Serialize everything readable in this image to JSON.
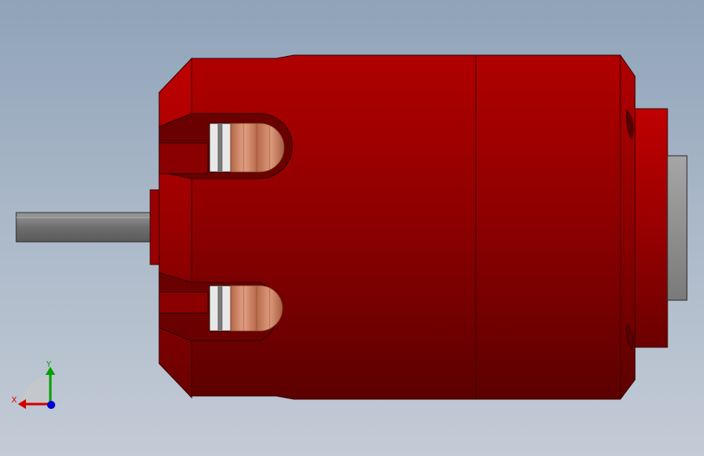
{
  "viewport": {
    "background_top": "#8fa3b9",
    "background_bottom": "#c3cbd6"
  },
  "model": {
    "body_color": "#b00000",
    "winding_color": "#c9785a",
    "shaft_color": "#707070"
  },
  "triad": {
    "x_label": "X",
    "y_label": "Y",
    "x_color": "#d40000",
    "y_color": "#00a000",
    "z_color": "#0000d0"
  }
}
